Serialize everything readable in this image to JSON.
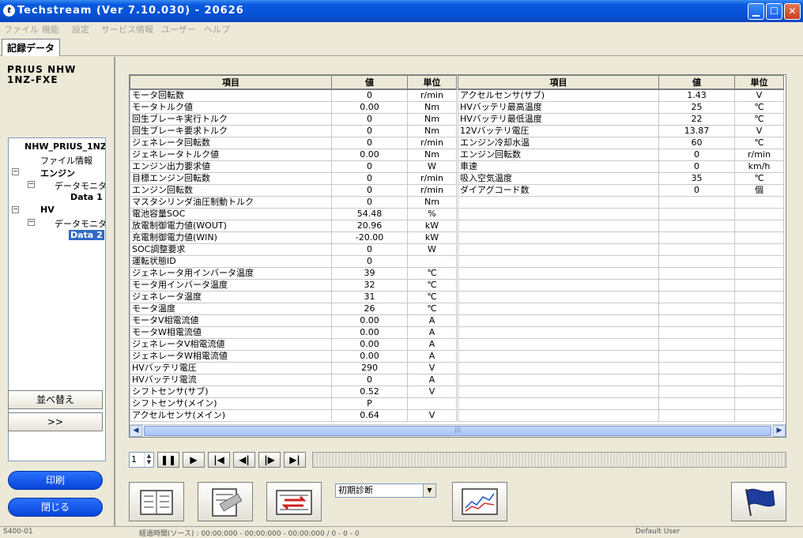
{
  "window": {
    "title": "Techstream (Ver 7.10.030) - 20626"
  },
  "menu": [
    "ファイル",
    "機能",
    "設定",
    "サービス情報",
    "ユーザー",
    "ヘルプ"
  ],
  "tab": {
    "label": "記録データ"
  },
  "vehicle": {
    "model": "PRIUS NHW",
    "engine": "1NZ-FXE"
  },
  "tree": {
    "root": "NHW_PRIUS_1NZ",
    "file_info": "ファイル情報",
    "engine": "エンジン",
    "data_monitor_1": "データモニタ",
    "data1": "Data 1",
    "hv": "HV",
    "data_monitor_2": "データモニタ",
    "data2": "Data 2"
  },
  "left_buttons": {
    "sort": "並べ替え",
    "expand": ">>",
    "print": "印刷",
    "close": "閉じる"
  },
  "table": {
    "headers": {
      "item": "項目",
      "value": "値",
      "unit": "単位"
    },
    "left_rows": [
      [
        "モータ回転数",
        "0",
        "r/min"
      ],
      [
        "モータトルク値",
        "0.00",
        "Nm"
      ],
      [
        "回生ブレーキ実行トルク",
        "0",
        "Nm"
      ],
      [
        "回生ブレーキ要求トルク",
        "0",
        "Nm"
      ],
      [
        "ジェネレータ回転数",
        "0",
        "r/min"
      ],
      [
        "ジェネレータトルク値",
        "0.00",
        "Nm"
      ],
      [
        "エンジン出力要求値",
        "0",
        "W"
      ],
      [
        "目標エンジン回転数",
        "0",
        "r/min"
      ],
      [
        "エンジン回転数",
        "0",
        "r/min"
      ],
      [
        "マスタシリンダ油圧制動トルク",
        "0",
        "Nm"
      ],
      [
        "電池容量SOC",
        "54.48",
        "%"
      ],
      [
        "放電制御電力値(WOUT)",
        "20.96",
        "kW"
      ],
      [
        "充電制御電力値(WIN)",
        "-20.00",
        "kW"
      ],
      [
        "SOC調整要求",
        "0",
        "W"
      ],
      [
        "運転状態ID",
        "0",
        ""
      ],
      [
        "ジェネレータ用インバータ温度",
        "39",
        "℃"
      ],
      [
        "モータ用インバータ温度",
        "32",
        "℃"
      ],
      [
        "ジェネレータ温度",
        "31",
        "℃"
      ],
      [
        "モータ温度",
        "26",
        "℃"
      ],
      [
        "モータV相電流値",
        "0.00",
        "A"
      ],
      [
        "モータW相電流値",
        "0.00",
        "A"
      ],
      [
        "ジェネレータV相電流値",
        "0.00",
        "A"
      ],
      [
        "ジェネレータW相電流値",
        "0.00",
        "A"
      ],
      [
        "HVバッテリ電圧",
        "290",
        "V"
      ],
      [
        "HVバッテリ電流",
        "0",
        "A"
      ],
      [
        "シフトセンサ(サブ)",
        "0.52",
        "V"
      ],
      [
        "シフトセンサ(メイン)",
        "P",
        ""
      ],
      [
        "アクセルセンサ(メイン)",
        "0.64",
        "V"
      ]
    ],
    "right_rows": [
      [
        "アクセルセンサ(サブ)",
        "1.43",
        "V"
      ],
      [
        "HVバッテリ最高温度",
        "25",
        "℃"
      ],
      [
        "HVバッテリ最低温度",
        "22",
        "℃"
      ],
      [
        "12Vバッテリ電圧",
        "13.87",
        "V"
      ],
      [
        "エンジン冷却水温",
        "60",
        "℃"
      ],
      [
        "エンジン回転数",
        "0",
        "r/min"
      ],
      [
        "車速",
        "0",
        "km/h"
      ],
      [
        "吸入空気温度",
        "35",
        "℃"
      ],
      [
        "ダイアグコード数",
        "0",
        "個"
      ]
    ]
  },
  "playback": {
    "frame": "1"
  },
  "toolbar": {
    "mode_select": "初期診断"
  },
  "status": {
    "left": "S400-01",
    "middle": "経過時間(ソース) : 00:00:000 - 00:00:000 - 00:00:000 / 0 - 0 - 0",
    "right": "Default User"
  }
}
